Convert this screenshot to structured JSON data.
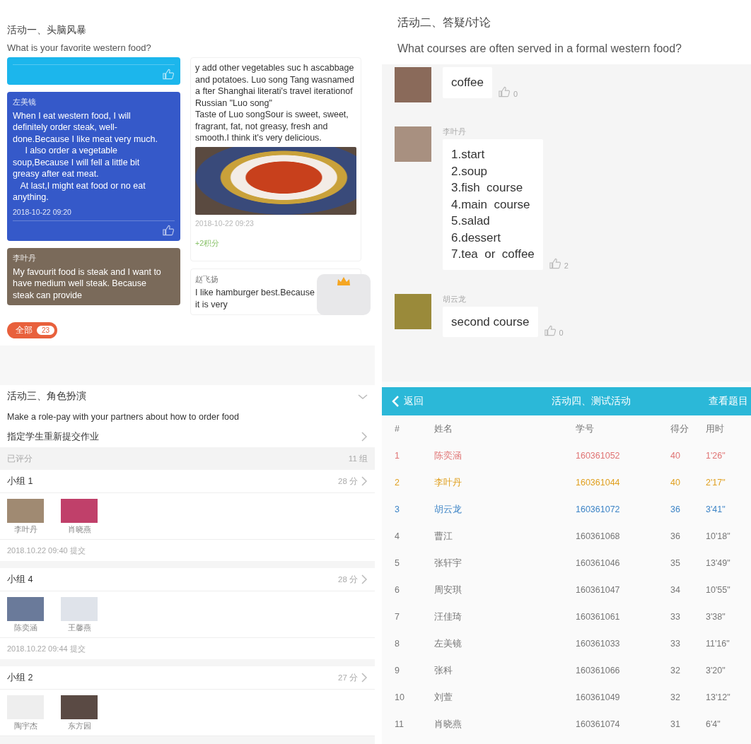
{
  "brainstorm": {
    "title": "活动一、头脑风暴",
    "question": "What is your favorite western food?",
    "left_cards": [
      {
        "color": "#1cb6ec"
      },
      {
        "color": "#3559c9",
        "name": "左美镜",
        "text": "When I eat western food, I will definitely order steak, well-done.Because I like meat very much.\n     I also order a vegetable soup,Because I will fell a little bit greasy after eat meat.\n   At last,I might eat food or no eat anything.",
        "time": "2018-10-22 09:20"
      },
      {
        "color": "#7a6a5a",
        "name": "李叶丹",
        "text": "My favourit food is steak and I want to have medium well steak. Because steak can provide"
      }
    ],
    "right_cards": [
      {
        "text": "y add other vegetables suc h ascabbage and potatoes. Luo song Tang wasnamed a fter Shanghai literati's travel iterationof Russian \"Luo song\"\nTaste of Luo songSour is sweet, sweet, fragrant, fat, not greasy, fresh and smooth.I think it's very delicious.",
        "photo": true,
        "time": "2018-10-22 09:23",
        "points": "+2积分"
      },
      {
        "name": "赵飞扬",
        "text": "I like hamburger best.Because it is very"
      }
    ],
    "filter": {
      "label": "全部",
      "count": "23"
    }
  },
  "roleplay": {
    "title": "活动三、角色扮演",
    "question": "Make a role-pay with your partners about how to order food",
    "assign": "指定学生重新提交作业",
    "summary_label": "已评分",
    "summary_count": "11 组",
    "groups": [
      {
        "name": "小组 1",
        "score": "28 分",
        "members": [
          "李叶丹",
          "肖晓燕"
        ],
        "time": "2018.10.22 09:40 提交"
      },
      {
        "name": "小组 4",
        "score": "28 分",
        "members": [
          "陈奕涵",
          "王馨燕"
        ],
        "time": "2018.10.22 09:44 提交"
      },
      {
        "name": "小组 2",
        "score": "27 分",
        "members": [
          "陶宇杰",
          "东方园"
        ]
      }
    ]
  },
  "discussion": {
    "title": "活动二、答疑/讨论",
    "question": "What courses are often served in a formal western food?",
    "posts": [
      {
        "text": "coffee",
        "likes": "0"
      },
      {
        "name": "李叶丹",
        "text": "1.start\n2.soup\n3.fish  course\n4.main  course\n5.salad\n6.dessert\n7.tea  or  coffee",
        "likes": "2"
      },
      {
        "name": "胡云龙",
        "text": "second course",
        "likes": "0"
      }
    ]
  },
  "quiz": {
    "back": "返回",
    "title": "活动四、测试活动",
    "action": "查看题目",
    "columns": [
      "#",
      "姓名",
      "学号",
      "得分",
      "用时"
    ],
    "rows": [
      {
        "color": "#e07474",
        "cells": [
          "1",
          "陈奕涵",
          "160361052",
          "40",
          "1'26\""
        ]
      },
      {
        "color": "#e0a020",
        "cells": [
          "2",
          "李叶丹",
          "160361044",
          "40",
          "2'17\""
        ]
      },
      {
        "color": "#3d84c6",
        "cells": [
          "3",
          "胡云龙",
          "160361072",
          "36",
          "3'41\""
        ]
      },
      {
        "cells": [
          "4",
          "曹江",
          "160361068",
          "36",
          "10'18\""
        ]
      },
      {
        "cells": [
          "5",
          "张轩宇",
          "160361046",
          "35",
          "13'49\""
        ]
      },
      {
        "cells": [
          "6",
          "周安琪",
          "160361047",
          "34",
          "10'55\""
        ]
      },
      {
        "cells": [
          "7",
          "汪佳琦",
          "160361061",
          "33",
          "3'38\""
        ]
      },
      {
        "cells": [
          "8",
          "左美镜",
          "160361033",
          "33",
          "11'16\""
        ]
      },
      {
        "cells": [
          "9",
          "张科",
          "160361066",
          "32",
          "3'20\""
        ]
      },
      {
        "cells": [
          "10",
          "刘萱",
          "160361049",
          "32",
          "13'12\""
        ]
      },
      {
        "cells": [
          "11",
          "肖晓燕",
          "160361074",
          "31",
          "6'4\""
        ]
      }
    ]
  }
}
